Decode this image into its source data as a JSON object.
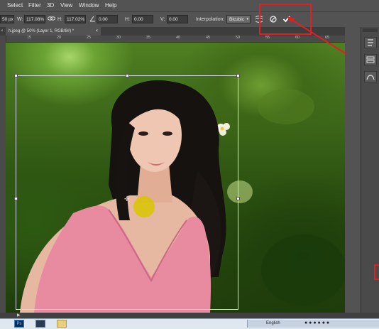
{
  "menu": {
    "items": [
      "Select",
      "Filter",
      "3D",
      "View",
      "Window",
      "Help"
    ]
  },
  "options": {
    "x_partial": "50 px",
    "w_label": "W:",
    "w_value": "117.08%",
    "link_icon": "chain-link-icon",
    "h_label": "H:",
    "h_value": "117.02%",
    "angle_icon": "angle-icon",
    "angle_value": "0.00",
    "h_skew_label": "H:",
    "h_skew_value": "0.00",
    "v_skew_label": "V:",
    "v_skew_value": "0.00",
    "interpolation_label": "Interpolation:",
    "interpolation_value": "Bicubic"
  },
  "tab": {
    "title": "h.jpeg @ 50% (Layer 1, RGB/8#) *"
  },
  "ruler_top": {
    "labels": [
      "15",
      "20",
      "25",
      "30",
      "35",
      "40",
      "45",
      "50",
      "55",
      "60",
      "65"
    ]
  },
  "taskbar": {
    "tray_language": "English"
  },
  "colors": {
    "highlight": "#e02020",
    "panel": "#535353",
    "dock": "#4a4a4a",
    "cursor_marker": "#d8c400"
  }
}
